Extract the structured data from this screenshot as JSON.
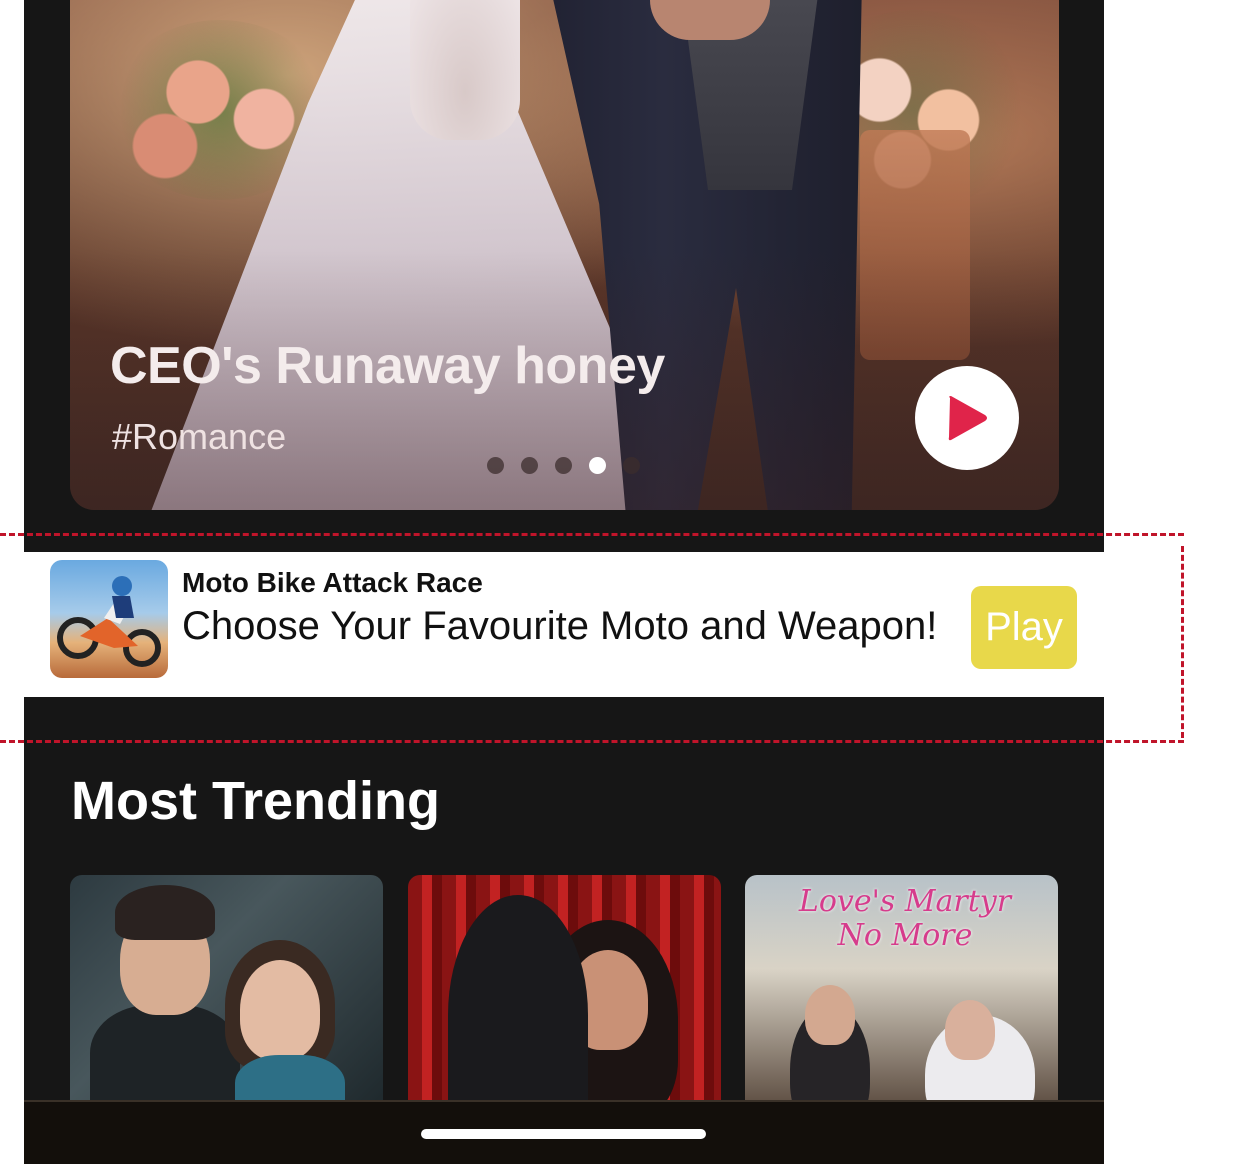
{
  "hero": {
    "title": "CEO's Runaway honey",
    "tag": "#Romance",
    "carousel": {
      "dot_count": 5,
      "active_index": 3
    },
    "play_icon": "play-triangle-icon",
    "accent_color": "#e0244a"
  },
  "ad": {
    "app_name": "Moto Bike Attack Race",
    "description": "Choose Your Favourite Moto and Weapon!",
    "play_label": "Play",
    "button_color": "#e8d84a",
    "icon": "moto-bike-app-icon"
  },
  "trending": {
    "title": "Most Trending",
    "cards": [
      {
        "cover_text": ""
      },
      {
        "cover_text": ""
      },
      {
        "cover_text": "Love's Martyr No More"
      }
    ]
  },
  "theme": {
    "background": "#161616",
    "outline_color": "#c0142a"
  }
}
